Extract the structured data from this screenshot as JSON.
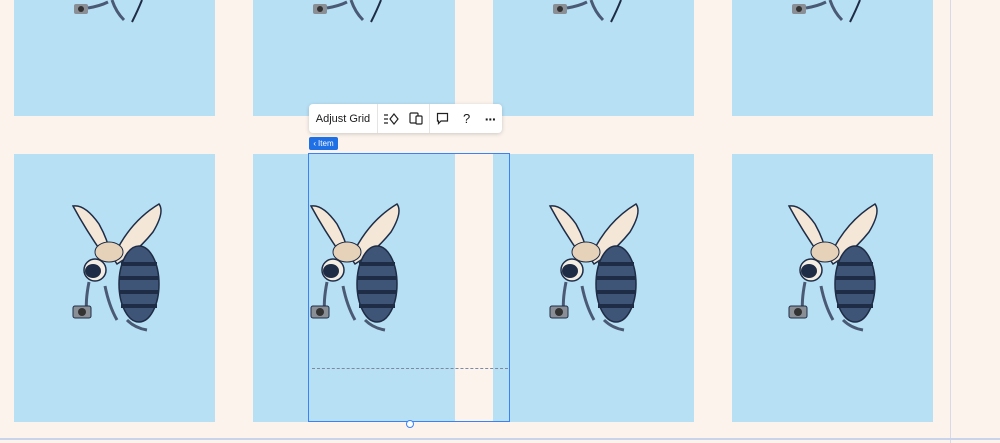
{
  "toolbar": {
    "adjust_grid_label": "Adjust Grid",
    "icons": [
      "arrange-icon",
      "layout-devices-icon",
      "comment-icon",
      "help-icon",
      "more-icon"
    ],
    "help_glyph": "?",
    "more_glyph": "···"
  },
  "breadcrumb_chip": {
    "label": "Item",
    "arrow": "‹"
  },
  "colors": {
    "canvas_bg": "#fbf3ec",
    "tile_bg": "#b8e0f5",
    "selection": "#3b82f6",
    "chip_bg": "#1f6fe5"
  },
  "grid": {
    "illustration": "bee-with-camera"
  }
}
